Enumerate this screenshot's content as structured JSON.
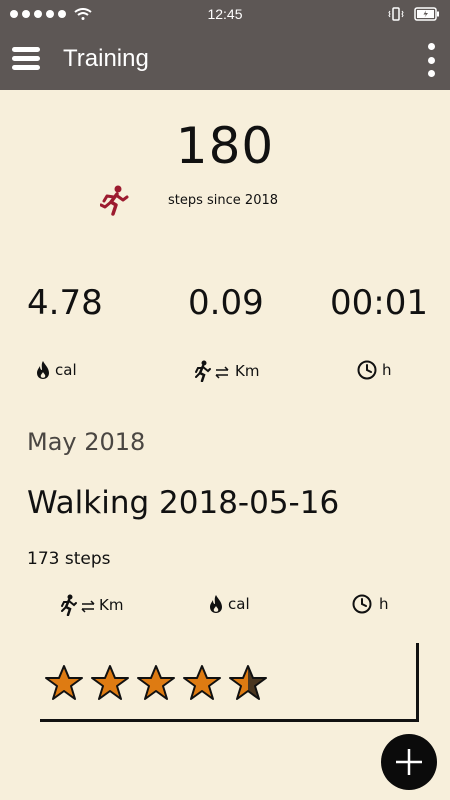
{
  "status_bar": {
    "time": "12:45",
    "signal_dots": 5,
    "icons": [
      "wifi-icon",
      "vibrate-icon",
      "battery-charging-icon"
    ]
  },
  "toolbar": {
    "title": "Training",
    "menu_icon": "hamburger-menu-icon",
    "more_icon": "more-vertical-icon"
  },
  "summary": {
    "steps": "180",
    "steps_caption": "steps since 2018",
    "icon": "running-icon",
    "icon_color": "#9c1b2f",
    "metrics": [
      {
        "value": "4.78",
        "unit": "cal",
        "icon": "flame-icon"
      },
      {
        "value": "0.09",
        "unit": "Km",
        "icon": "walking-distance-icon"
      },
      {
        "value": "00:01",
        "unit": "h",
        "icon": "clock-icon"
      }
    ]
  },
  "month": {
    "label": "May 2018"
  },
  "session": {
    "title": "Walking 2018-05-16",
    "steps": "173 steps",
    "units": [
      {
        "unit": "Km",
        "icon": "walking-distance-icon"
      },
      {
        "unit": "cal",
        "icon": "flame-icon"
      },
      {
        "unit": "h",
        "icon": "clock-icon"
      }
    ],
    "rating": 4.5,
    "rating_max": 5,
    "star_color": "#de7b12"
  },
  "fab": {
    "icon": "plus-icon"
  },
  "colors": {
    "header": "#5d5755",
    "background": "#f7efdb",
    "accent": "#de7b12"
  }
}
